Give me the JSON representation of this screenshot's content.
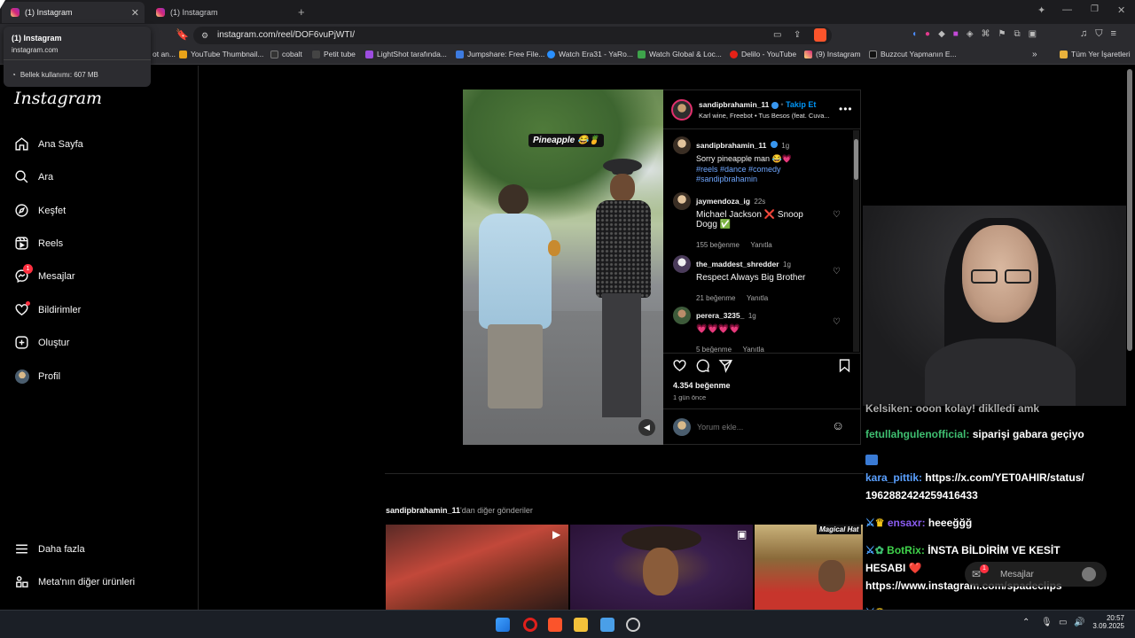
{
  "browser": {
    "tabs": [
      {
        "title": "(1) Instagram",
        "active": true
      },
      {
        "title": "(1) Instagram",
        "active": false
      }
    ],
    "url": "instagram.com/reel/DOF6vuPjWTI/",
    "bookmarks": [
      "ot an...",
      "YouTube Thumbnail...",
      "cobalt",
      "Petit tube",
      "LightShot tarafında...",
      "Jumpshare: Free File...",
      "Watch Era31 - YaRo...",
      "Watch Global & Loc...",
      "Delilo - YouTube",
      "(9) Instagram",
      "Buzzcut Yapmanın E..."
    ],
    "all_bookmarks_label": "Tüm Yer İşaretleri",
    "tooltip": {
      "title": "(1) Instagram",
      "domain": "instagram.com",
      "memory": "Bellek kullanımı: 607 MB"
    }
  },
  "sidebar": {
    "logo": "Instagram",
    "items": [
      {
        "label": "Ana Sayfa",
        "icon": "home-icon"
      },
      {
        "label": "Ara",
        "icon": "search-icon"
      },
      {
        "label": "Keşfet",
        "icon": "compass-icon"
      },
      {
        "label": "Reels",
        "icon": "reels-icon"
      },
      {
        "label": "Mesajlar",
        "icon": "messenger-icon",
        "badge": "1"
      },
      {
        "label": "Bildirimler",
        "icon": "heart-icon"
      },
      {
        "label": "Oluştur",
        "icon": "plus-square-icon"
      },
      {
        "label": "Profil",
        "icon": "avatar"
      }
    ],
    "more": "Daha fazla",
    "meta": "Meta'nın diğer ürünleri"
  },
  "post": {
    "overlay_caption": "Pineapple 😂🍍",
    "author": "sandipbrahamin_11",
    "follow": "Takip Et",
    "audio": "Karl wine, Freebot • Tus Besos (feat. Cuva...",
    "caption": {
      "user": "sandipbrahamin_11",
      "time": "1g",
      "text": "Sorry pineapple man 😂💗",
      "tags": "#reels #dance #comedy",
      "tags2": "#sandipbrahamin"
    },
    "comments": [
      {
        "user": "jaymendoza_ig",
        "time": "22s",
        "text": "Michael Jackson ❌ Snoop",
        "text2": "Dogg ✅",
        "likes": "155 beğenme",
        "reply": "Yanıtla"
      },
      {
        "user": "the_maddest_shredder",
        "time": "1g",
        "text": "Respect Always Big Brother",
        "likes": "21 beğenme",
        "reply": "Yanıtla"
      },
      {
        "user": "perera_3235_",
        "time": "1g",
        "text": "💗💗💗💗",
        "likes": "5 beğenme",
        "reply": "Yanıtla"
      }
    ],
    "likes": "4.354 beğenme",
    "date": "1 gün önce",
    "comment_placeholder": "Yorum ekle..."
  },
  "more_posts": {
    "label_user": "sandipbrahamin_11",
    "label_rest": "'dan diğer gönderiler",
    "third_caption": "Magical Hat"
  },
  "stream": {
    "chat": [
      {
        "user": "",
        "text": "Kelsiken: ooon kolay! diklledi amk"
      },
      {
        "user": "fetullahgulenofficial:",
        "text": "siparişi gabara geçiyo"
      },
      {
        "user": "kara_pittik:",
        "text": "https://x.com/YET0AHIR/status/",
        "text2": "1962882424259416433"
      },
      {
        "user": "ensaxr:",
        "text": "heeeğğğ"
      },
      {
        "user": "BotRix:",
        "text": "İNSTA BİLDİRİM VE KESİT",
        "text2": "HESABI ❤️",
        "text3": "https://www.instagram.com/spadeclips"
      },
      {
        "user": "ensaxr:",
        "text": ""
      }
    ],
    "messages_pill": "Mesajlar",
    "messages_badge": "1"
  },
  "taskbar": {
    "time": "20:57",
    "date": "3.09.2025"
  }
}
